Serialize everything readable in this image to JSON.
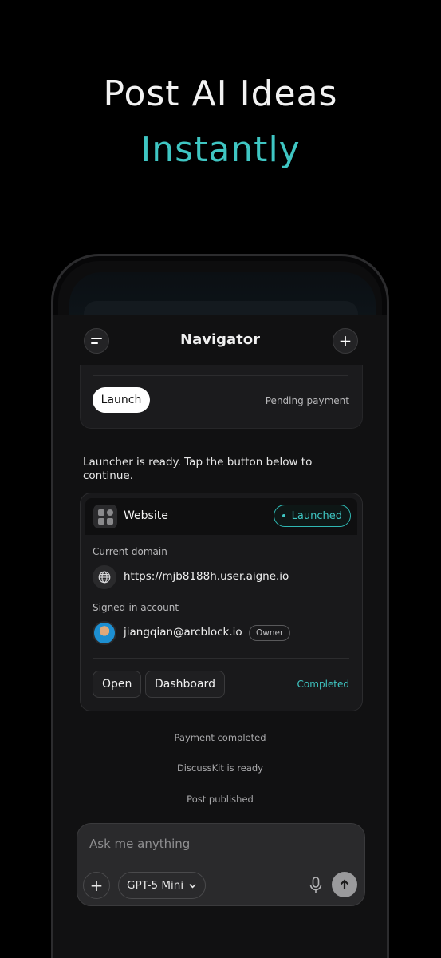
{
  "hero": {
    "line1": "Post AI Ideas",
    "line2": "Instantly"
  },
  "nav": {
    "title": "Navigator"
  },
  "launch_card": {
    "button_label": "Launch",
    "status": "Pending payment"
  },
  "message": "Launcher is ready. Tap the button below to continue.",
  "website_card": {
    "title": "Website",
    "badge": "Launched",
    "domain_label": "Current domain",
    "domain": "https://mjb8188h.user.aigne.io",
    "account_label": "Signed-in account",
    "email": "jiangqian@arcblock.io",
    "role": "Owner",
    "open_label": "Open",
    "dashboard_label": "Dashboard",
    "completion": "Completed"
  },
  "statuses": [
    "Payment completed",
    "DiscussKit is ready",
    "Post published"
  ],
  "composer": {
    "placeholder": "Ask me anything",
    "model": "GPT-5 Mini"
  },
  "colors": {
    "accent": "#3fc6c3",
    "background": "#000000"
  }
}
